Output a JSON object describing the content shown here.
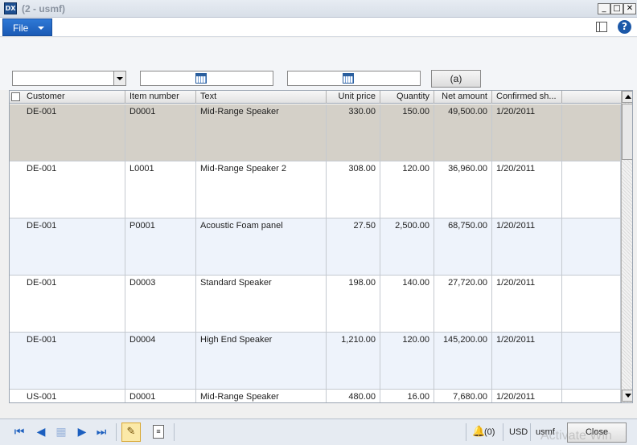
{
  "window": {
    "title": "(2 - usmf)",
    "app_icon": "app-icon"
  },
  "menu": {
    "file_label": "File"
  },
  "filters": {
    "button_label": "(a)"
  },
  "grid": {
    "columns": [
      "Customer",
      "Item number",
      "Text",
      "Unit price",
      "Quantity",
      "Net amount",
      "Confirmed sh..."
    ],
    "rows": [
      [
        "DE-001",
        "D0001",
        "Mid-Range Speaker",
        "330.00",
        "150.00",
        "49,500.00",
        "1/20/2011"
      ],
      [
        "DE-001",
        "L0001",
        "Mid-Range Speaker 2",
        "308.00",
        "120.00",
        "36,960.00",
        "1/20/2011"
      ],
      [
        "DE-001",
        "P0001",
        "Acoustic Foam panel",
        "27.50",
        "2,500.00",
        "68,750.00",
        "1/20/2011"
      ],
      [
        "DE-001",
        "D0003",
        "Standard Speaker",
        "198.00",
        "140.00",
        "27,720.00",
        "1/20/2011"
      ],
      [
        "DE-001",
        "D0004",
        "High End Speaker",
        "1,210.00",
        "120.00",
        "145,200.00",
        "1/20/2011"
      ],
      [
        "US-001",
        "D0001",
        "Mid-Range Speaker",
        "480.00",
        "16.00",
        "7,680.00",
        "1/20/2011"
      ]
    ]
  },
  "status": {
    "notifications": "(0)",
    "currency": "USD",
    "company": "usmf",
    "close_label": "Close",
    "watermark": "Activate Win"
  }
}
